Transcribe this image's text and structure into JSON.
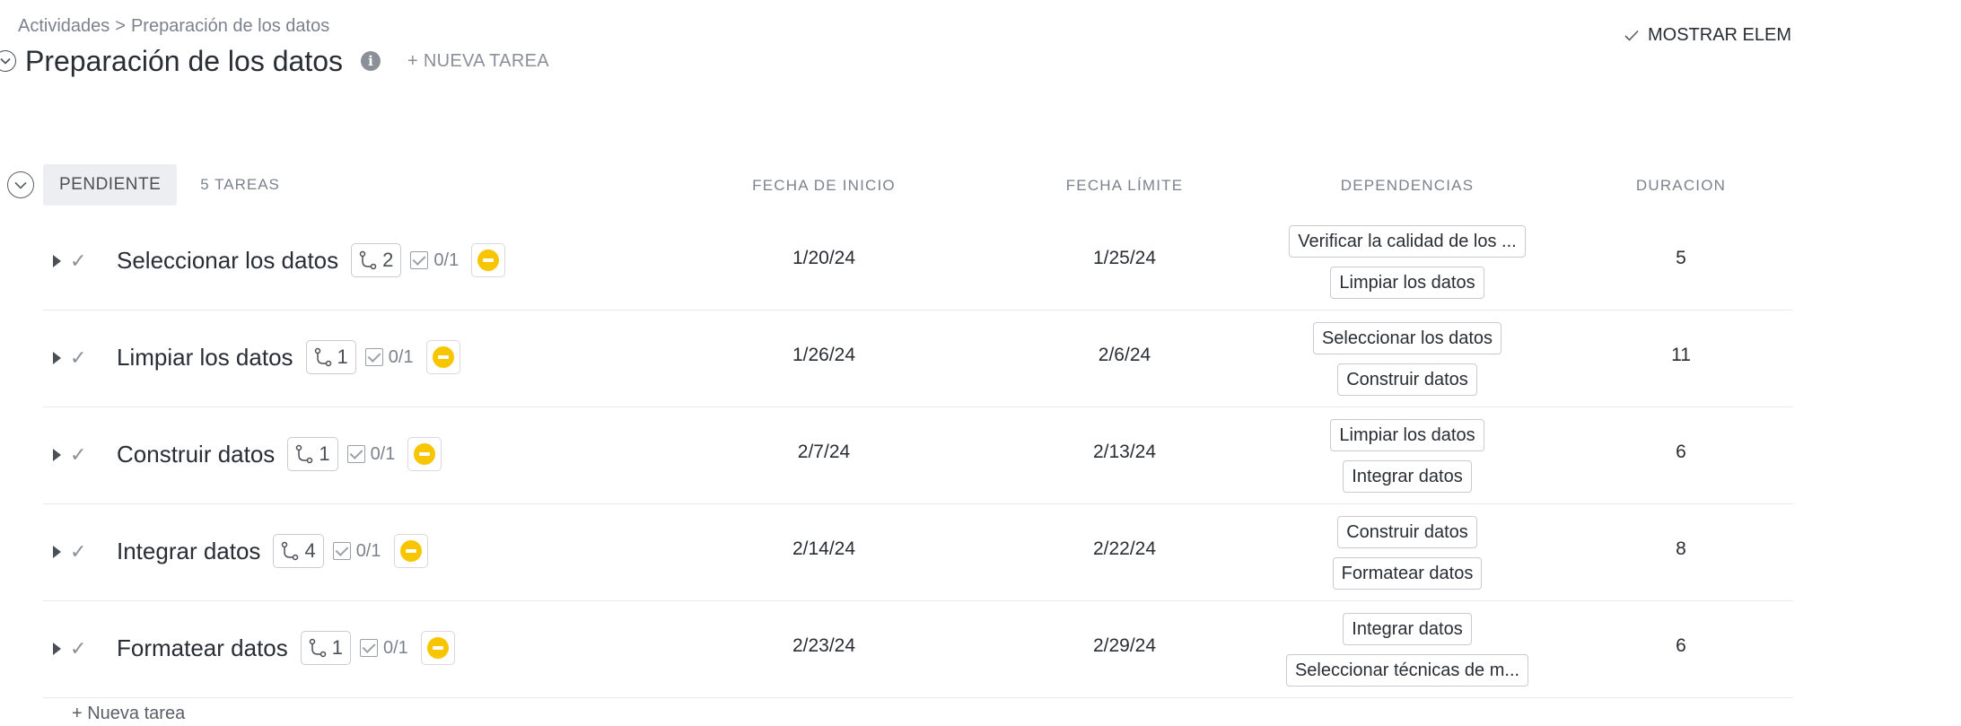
{
  "breadcrumb": {
    "parent": "Actividades",
    "separator": ">",
    "current": "Preparación de los datos"
  },
  "header": {
    "title": "Preparación de los datos",
    "new_task": "+ NUEVA TAREA",
    "show_items": "MOSTRAR ELEM"
  },
  "group": {
    "status": "PENDIENTE",
    "count": "5 TAREAS"
  },
  "columns": {
    "start": "FECHA DE INICIO",
    "due": "FECHA LÍMITE",
    "deps": "DEPENDENCIAS",
    "duration": "DURACION"
  },
  "tasks": [
    {
      "name": "Seleccionar los datos",
      "subtasks": "2",
      "checklist": "0/1",
      "start": "1/20/24",
      "due": "1/25/24",
      "deps": [
        "Verificar la calidad de los ...",
        "Limpiar los datos"
      ],
      "duration": "5"
    },
    {
      "name": "Limpiar los datos",
      "subtasks": "1",
      "checklist": "0/1",
      "start": "1/26/24",
      "due": "2/6/24",
      "deps": [
        "Seleccionar los datos",
        "Construir datos"
      ],
      "duration": "11"
    },
    {
      "name": "Construir datos",
      "subtasks": "1",
      "checklist": "0/1",
      "start": "2/7/24",
      "due": "2/13/24",
      "deps": [
        "Limpiar los datos",
        "Integrar datos"
      ],
      "duration": "6"
    },
    {
      "name": "Integrar datos",
      "subtasks": "4",
      "checklist": "0/1",
      "start": "2/14/24",
      "due": "2/22/24",
      "deps": [
        "Construir datos",
        "Formatear datos"
      ],
      "duration": "8"
    },
    {
      "name": "Formatear datos",
      "subtasks": "1",
      "checklist": "0/1",
      "start": "2/23/24",
      "due": "2/29/24",
      "deps": [
        "Integrar datos",
        "Seleccionar técnicas de m..."
      ],
      "duration": "6"
    }
  ],
  "footer": {
    "new_task": "+ Nueva tarea"
  },
  "colors": {
    "priority": "#f8c600",
    "muted_text": "#7c828d",
    "border": "#c8ccd2"
  }
}
